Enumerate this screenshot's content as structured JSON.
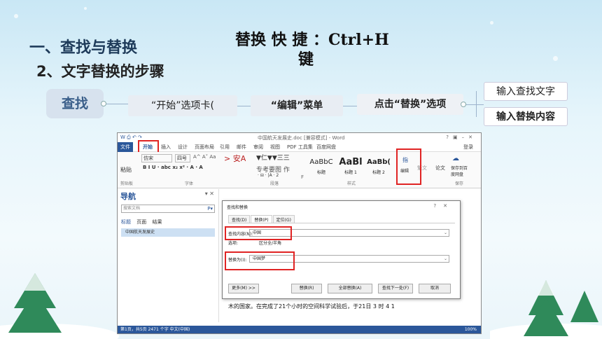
{
  "slide": {
    "heading1": "一、查找与替换",
    "heading2": "2、文字替换的步骤",
    "shortcut_line1": "替换 快 捷 ：Ctrl+H",
    "shortcut_line2": "键"
  },
  "mindmap": {
    "root": "查找",
    "step1": "“开始”选项卡(",
    "step2": "“编辑”菜单",
    "step3": "点击“替换”选项",
    "step4": "输入查找文字",
    "step5": "输入替换内容"
  },
  "word": {
    "title": "中国航天发展史.doc [兼容模式] - Word",
    "tabs": [
      "文件",
      "开始",
      "插入",
      "设计",
      "页面布局",
      "引用",
      "邮件",
      "审阅",
      "视图",
      "PDF 工具集",
      "百度网盘"
    ],
    "login": "登录",
    "ribbon": {
      "paste": "粘贴",
      "font_name": "仿宋",
      "font_size": "四号",
      "font_group": "字体",
      "clipboard_group": "剪贴板",
      "paragraph_group": "段落",
      "styles_group": "样式",
      "style_normal": "AaBbC",
      "style_normal_label": "标题",
      "style_h1": "AaBl",
      "style_h1_label": "标题 1",
      "style_h2": "AaBb(",
      "style_h2_label": "标题 2",
      "edit_label": "编辑",
      "find_label": "指",
      "plain": "繁文",
      "paper": "论文",
      "cloud": "保存到百度网盘",
      "save_group": "保存"
    },
    "nav": {
      "title": "导航",
      "search_placeholder": "搜索文档",
      "tabs": [
        "标题",
        "页面",
        "结果"
      ],
      "item": "中国航天发展史"
    },
    "dialog": {
      "title": "查找和替换",
      "tabs": [
        "查找(D)",
        "替换(P)",
        "定位(G)"
      ],
      "find_label": "查找内容(N):",
      "find_value": "中国",
      "options_label": "选项:",
      "options_value": "区分全/半角",
      "replace_label": "替换为(I):",
      "replace_value": "中国梦",
      "more_button": "更多(M) >>",
      "replace_button": "替换(R)",
      "replace_all_button": "全部替换(A)",
      "find_next_button": "查找下一处(F)",
      "cancel_button": "取消"
    },
    "doc_text": "木的国家。在完成了21个小时的空间科学试验后，于21日 3 时 4 1",
    "status": "第1页，共5页   2471 个字   中文(中国)",
    "zoom": "100%"
  }
}
